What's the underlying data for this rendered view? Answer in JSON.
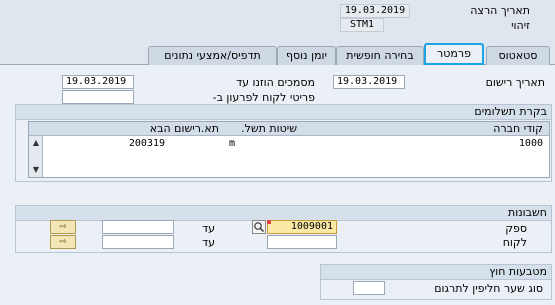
{
  "header": {
    "run_date_label": "תאריך הרצה",
    "run_date_value": "19.03.2019",
    "id_label": "זיהוי",
    "id_value": "STM1"
  },
  "tabs": [
    {
      "label": "סטאטוס",
      "active": false
    },
    {
      "label": "פרמטר",
      "active": true
    },
    {
      "label": "בחירה חופשית",
      "active": false
    },
    {
      "label": "יומן נוסף",
      "active": false
    },
    {
      "label": "תדפיס/אמצעי נתונים",
      "active": false
    }
  ],
  "params": {
    "posting_date_label": "תאריך רישום",
    "posting_date_value": "19.03.2019",
    "docs_until_label": "מסמכים הוזנו עד",
    "docs_until_value": "19.03.2019",
    "customer_items_label": "פריטי לקוח לפרעון ב-",
    "customer_items_value": ""
  },
  "payment_control": {
    "title": "בקרת תשלומים",
    "columns": [
      "קודי חברה",
      "שיטות תשל.",
      "תא.רישום הבא"
    ],
    "rows": [
      {
        "company_code": "1000",
        "pay_methods": "m",
        "next_posting": "200319"
      }
    ]
  },
  "accounts": {
    "title": "חשבונות",
    "vendor_label": "ספק",
    "vendor_from": "1009001",
    "vendor_to_label": "עד",
    "vendor_to": "",
    "customer_label": "לקוח",
    "customer_from": "",
    "customer_to_label": "עד",
    "customer_to": ""
  },
  "foreign_currency": {
    "title": "מטבעות חוץ",
    "rate_type_label": "סוג שער חליפין לתרגום",
    "rate_type_value": ""
  },
  "colors": {
    "active_tab_border": "#1aa4e6",
    "required_mark": "#e0443a",
    "highlight_field": "#fbe9a6"
  }
}
